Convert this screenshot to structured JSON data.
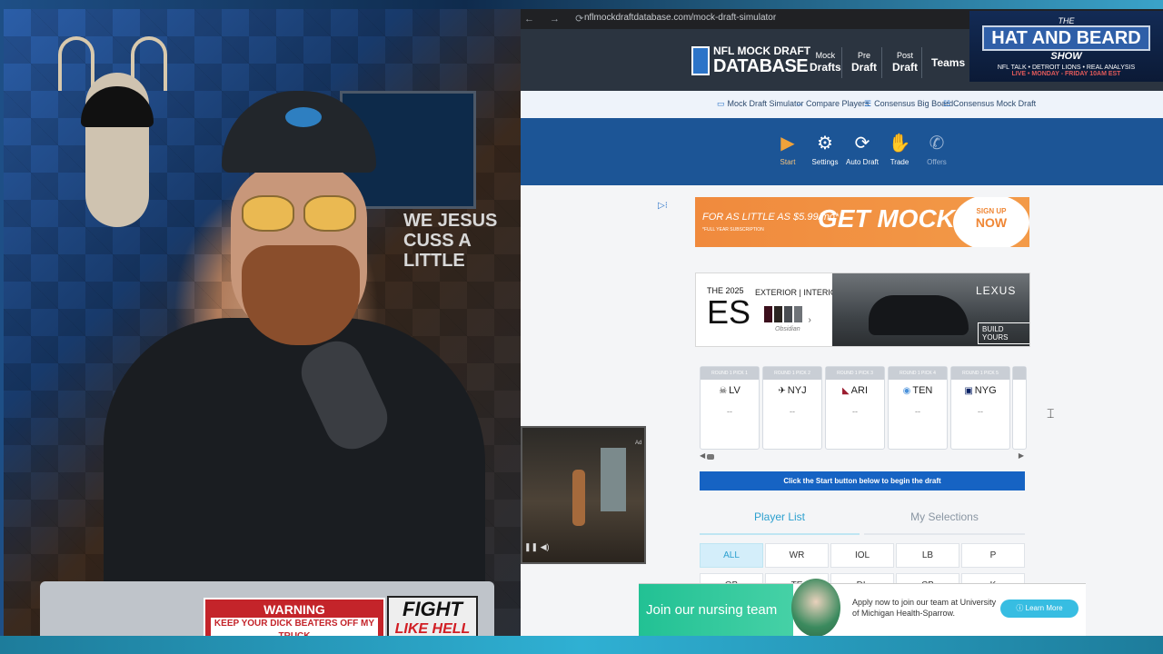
{
  "browser": {
    "nav_icons": "← → ⟳",
    "url": "nflmockdraftdatabase.com/mock-draft-simulator"
  },
  "header": {
    "logo_line1": "NFL MOCK DRAFT",
    "logo_line2": "DATABASE",
    "nav": [
      {
        "top": "Mock",
        "bottom": "Drafts"
      },
      {
        "top": "Pre",
        "bottom": "Draft"
      },
      {
        "top": "Post",
        "bottom": "Draft"
      },
      {
        "top": "",
        "bottom": "Teams"
      }
    ]
  },
  "overlay_banner": {
    "the": "THE",
    "title": "HAT AND BEARD",
    "show": "SHOW",
    "tagline": "NFL TALK • DETROIT LIONS • REAL ANALYSIS",
    "schedule": "LIVE • MONDAY - FRIDAY 10AM EST"
  },
  "subnav": [
    {
      "icon": "▭",
      "label": "Mock Draft Simulator"
    },
    {
      "icon": "⇔",
      "label": "Compare Players"
    },
    {
      "icon": "☰",
      "label": "Consensus Big Board"
    },
    {
      "icon": "☷",
      "label": "Consensus Mock Draft"
    }
  ],
  "toolbar": [
    {
      "icon": "▶",
      "label": "Start"
    },
    {
      "icon": "⚙",
      "label": "Settings"
    },
    {
      "icon": "⟳",
      "label": "Auto Draft"
    },
    {
      "icon": "✋",
      "label": "Trade"
    },
    {
      "icon": "✆",
      "label": "Offers"
    }
  ],
  "ad_getmock": {
    "price_line": "FOR AS LITTLE AS $5.99/mo*",
    "fine_print": "*FULL YEAR SUBSCRIPTION",
    "headline": "GET MOCK+",
    "cta_top": "SIGN UP",
    "cta_bottom": "NOW"
  },
  "ad_lexus": {
    "year": "THE 2025",
    "model": "ES",
    "tabs": "EXTERIOR | INTERIOR",
    "color_name": "Obsidian",
    "brand": "LEXUS",
    "cta": "BUILD YOURS",
    "swatch_colors": [
      "#3b0f1c",
      "#2a2420",
      "#4a4d52",
      "#6f7378"
    ]
  },
  "picks": [
    {
      "header": "ROUND 1 PICK 1",
      "icon": "☠",
      "team": "LV",
      "player": "--"
    },
    {
      "header": "ROUND 1 PICK 2",
      "icon": "✈",
      "team": "NYJ",
      "player": "--"
    },
    {
      "header": "ROUND 1 PICK 3",
      "icon": "◣",
      "team": "ARI",
      "player": "--"
    },
    {
      "header": "ROUND 1 PICK 4",
      "icon": "◉",
      "team": "TEN",
      "player": "--"
    },
    {
      "header": "ROUND 1 PICK 5",
      "icon": "▣",
      "team": "NYG",
      "player": "--"
    }
  ],
  "notice": "Click the Start button below to begin the draft",
  "tabs": {
    "player_list": "Player List",
    "my_selections": "My Selections"
  },
  "positions": [
    "ALL",
    "WR",
    "IOL",
    "LB",
    "P",
    "QB",
    "TE",
    "DL",
    "CB",
    "K"
  ],
  "nurse_ad": {
    "headline": "Join our nursing team",
    "body": "Apply now to join our team at University of Michigan Health-Sparrow.",
    "cta": "Learn More"
  },
  "webcam": {
    "poster_text": "WE JESUS\nCUSS A LITTLE",
    "sticker_warning": "WARNING",
    "sticker_warning_sub": "KEEP YOUR DICK BEATERS OFF MY TRUCK",
    "sticker_fight_1": "FIGHT",
    "sticker_fight_2": "LIKE HELL"
  }
}
